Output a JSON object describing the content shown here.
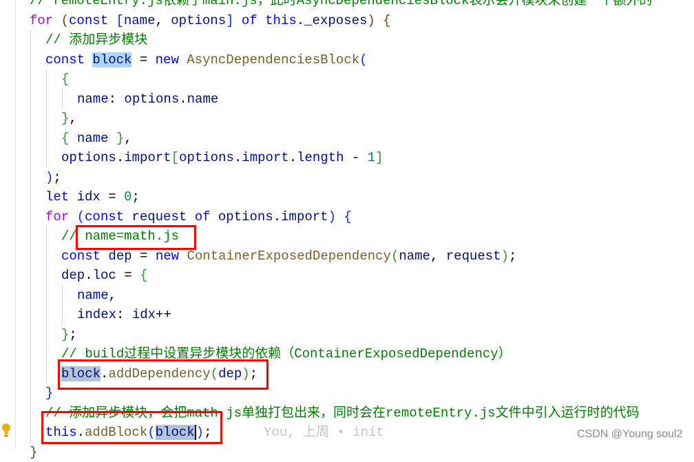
{
  "lines": [
    {
      "indent": 0,
      "tokens": [
        [
          "// remoteEntry.js依赖了main.js，此时AsyncDependenciesBlock表示会开模块来创建一个额外的",
          "cm"
        ]
      ]
    },
    {
      "indent": 0,
      "tokens": [
        [
          "for",
          "ctrl"
        ],
        [
          " ",
          "p"
        ],
        [
          "(",
          "b3"
        ],
        [
          "const",
          "kw"
        ],
        [
          " ",
          "p"
        ],
        [
          "[",
          "b1"
        ],
        [
          "name",
          "var"
        ],
        [
          ", ",
          "p"
        ],
        [
          "options",
          "var"
        ],
        [
          "]",
          "b1"
        ],
        [
          " ",
          "p"
        ],
        [
          "of",
          "kw"
        ],
        [
          " ",
          "p"
        ],
        [
          "this",
          "kw"
        ],
        [
          "._exposes",
          "var"
        ],
        [
          ")",
          "b3"
        ],
        [
          " ",
          "p"
        ],
        [
          "{",
          "b3"
        ]
      ]
    },
    {
      "indent": 1,
      "tokens": [
        [
          "// 添加异步模块",
          "cm"
        ]
      ]
    },
    {
      "indent": 1,
      "tokens": [
        [
          "const",
          "kw"
        ],
        [
          " ",
          "p"
        ],
        [
          "block",
          "var hl"
        ],
        [
          " = ",
          "p"
        ],
        [
          "new",
          "kw"
        ],
        [
          " ",
          "p"
        ],
        [
          "AsyncDependenciesBlock",
          "fn"
        ],
        [
          "(",
          "b1"
        ]
      ]
    },
    {
      "indent": 2,
      "tokens": [
        [
          "{",
          "b2"
        ]
      ]
    },
    {
      "indent": 3,
      "tokens": [
        [
          "name",
          "var"
        ],
        [
          ": ",
          "p"
        ],
        [
          "options",
          "var"
        ],
        [
          ".",
          "p"
        ],
        [
          "name",
          "var"
        ]
      ]
    },
    {
      "indent": 2,
      "tokens": [
        [
          "}",
          "b2"
        ],
        [
          ",",
          "p"
        ]
      ]
    },
    {
      "indent": 2,
      "tokens": [
        [
          "{",
          "b2"
        ],
        [
          " ",
          "p"
        ],
        [
          "name",
          "var"
        ],
        [
          " ",
          "p"
        ],
        [
          "}",
          "b2"
        ],
        [
          ",",
          "p"
        ]
      ]
    },
    {
      "indent": 2,
      "tokens": [
        [
          "options",
          "var"
        ],
        [
          ".",
          "p"
        ],
        [
          "import",
          "var"
        ],
        [
          "[",
          "b2"
        ],
        [
          "options",
          "var"
        ],
        [
          ".",
          "p"
        ],
        [
          "import",
          "var"
        ],
        [
          ".",
          "p"
        ],
        [
          "length",
          "var"
        ],
        [
          " - ",
          "p"
        ],
        [
          "1",
          "num"
        ],
        [
          "]",
          "b2"
        ]
      ]
    },
    {
      "indent": 1,
      "tokens": [
        [
          ")",
          "b1"
        ],
        [
          ";",
          "p"
        ]
      ]
    },
    {
      "indent": 1,
      "tokens": [
        [
          "let",
          "kw"
        ],
        [
          " ",
          "p"
        ],
        [
          "idx",
          "var"
        ],
        [
          " = ",
          "p"
        ],
        [
          "0",
          "num"
        ],
        [
          ";",
          "p"
        ]
      ]
    },
    {
      "indent": 1,
      "tokens": [
        [
          "for",
          "ctrl"
        ],
        [
          " ",
          "p"
        ],
        [
          "(",
          "b1"
        ],
        [
          "const",
          "kw"
        ],
        [
          " ",
          "p"
        ],
        [
          "request",
          "var"
        ],
        [
          " ",
          "p"
        ],
        [
          "of",
          "kw"
        ],
        [
          " ",
          "p"
        ],
        [
          "options",
          "var"
        ],
        [
          ".",
          "p"
        ],
        [
          "import",
          "var"
        ],
        [
          ")",
          "b1"
        ],
        [
          " ",
          "p"
        ],
        [
          "{",
          "b1"
        ]
      ]
    },
    {
      "indent": 2,
      "tokens": [
        [
          "// name=math.js",
          "cm"
        ]
      ]
    },
    {
      "indent": 2,
      "tokens": [
        [
          "const",
          "kw"
        ],
        [
          " ",
          "p"
        ],
        [
          "dep",
          "var"
        ],
        [
          " = ",
          "p"
        ],
        [
          "new",
          "kw"
        ],
        [
          " ",
          "p"
        ],
        [
          "ContainerExposedDependency",
          "fn"
        ],
        [
          "(",
          "b2"
        ],
        [
          "name",
          "var"
        ],
        [
          ", ",
          "p"
        ],
        [
          "request",
          "var"
        ],
        [
          ")",
          "b2"
        ],
        [
          ";",
          "p"
        ]
      ]
    },
    {
      "indent": 2,
      "tokens": [
        [
          "dep",
          "var"
        ],
        [
          ".",
          "p"
        ],
        [
          "loc",
          "var"
        ],
        [
          " = ",
          "p"
        ],
        [
          "{",
          "b2"
        ]
      ]
    },
    {
      "indent": 3,
      "tokens": [
        [
          "name",
          "var"
        ],
        [
          ",",
          "p"
        ]
      ]
    },
    {
      "indent": 3,
      "tokens": [
        [
          "index",
          "var"
        ],
        [
          ": ",
          "p"
        ],
        [
          "idx",
          "var"
        ],
        [
          "++",
          "p"
        ]
      ]
    },
    {
      "indent": 2,
      "tokens": [
        [
          "}",
          "b2"
        ],
        [
          ";",
          "p"
        ]
      ]
    },
    {
      "indent": 2,
      "tokens": [
        [
          "// build过程中设置异步模块的依赖（ContainerExposedDependency）",
          "cm"
        ]
      ]
    },
    {
      "indent": 2,
      "tokens": [
        [
          "block",
          "var hl2"
        ],
        [
          ".",
          "p"
        ],
        [
          "addDependency",
          "fn"
        ],
        [
          "(",
          "b2"
        ],
        [
          "dep",
          "var"
        ],
        [
          ")",
          "b2"
        ],
        [
          ";",
          "p"
        ]
      ]
    },
    {
      "indent": 1,
      "tokens": [
        [
          "}",
          "b1"
        ]
      ]
    },
    {
      "indent": 1,
      "tokens": [
        [
          "// 添加异步模块，会把math.js单独打包出来，同时会在remoteEntry.js文件中引入运行时的代码",
          "cm"
        ]
      ]
    },
    {
      "indent": 1,
      "tokens": [
        [
          "this",
          "kw"
        ],
        [
          ".",
          "p"
        ],
        [
          "addBlock",
          "fn"
        ],
        [
          "(",
          "b1"
        ],
        [
          "block",
          "var hl2 cursor"
        ],
        [
          ")",
          "b1"
        ],
        [
          ";",
          "p"
        ]
      ]
    },
    {
      "indent": 0,
      "tokens": [
        [
          "}",
          "b3"
        ]
      ]
    }
  ],
  "blame": "You, 上周 • init",
  "watermark": "CSDN @Young soul2",
  "icons": {
    "lightbulb": "lightbulb-icon"
  },
  "colors": {
    "keyword": "#0000ff",
    "control": "#af00db",
    "variable": "#001080",
    "function": "#795e26",
    "comment": "#008000",
    "number": "#098658",
    "annotation_box": "#ff0000"
  }
}
